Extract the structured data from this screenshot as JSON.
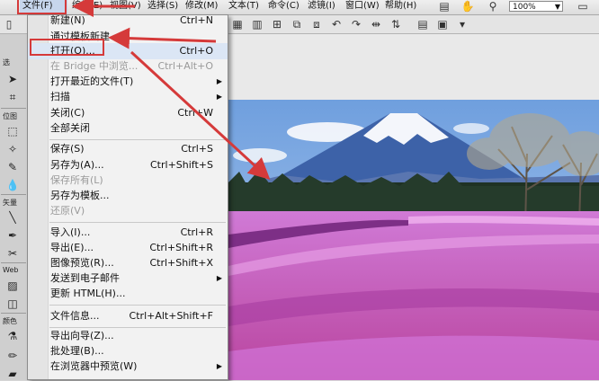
{
  "menubar": {
    "items": [
      {
        "label": "文件(F)"
      },
      {
        "label": "编辑(E)"
      },
      {
        "label": "视图(V)"
      },
      {
        "label": "选择(S)"
      },
      {
        "label": "修改(M)"
      },
      {
        "label": "文本(T)"
      },
      {
        "label": "命令(C)"
      },
      {
        "label": "滤镜(I)"
      },
      {
        "label": "窗口(W)"
      },
      {
        "label": "帮助(H)"
      }
    ],
    "zoom": "100%"
  },
  "tools": {
    "labels": [
      "选",
      "位图",
      "矢量",
      "Web",
      "颜色"
    ]
  },
  "file_menu": {
    "items": [
      {
        "label": "新建(N)",
        "shortcut": "Ctrl+N"
      },
      {
        "label": "通过模板新建"
      },
      {
        "label": "打开(O)...",
        "shortcut": "Ctrl+O"
      },
      {
        "label": "在 Bridge 中浏览...",
        "shortcut": "Ctrl+Alt+O"
      },
      {
        "label": "打开最近的文件(T)"
      },
      {
        "label": "扫描"
      },
      {
        "label": "关闭(C)",
        "shortcut": "Ctrl+W"
      },
      {
        "label": "全部关闭"
      },
      {
        "label": "保存(S)",
        "shortcut": "Ctrl+S"
      },
      {
        "label": "另存为(A)...",
        "shortcut": "Ctrl+Shift+S"
      },
      {
        "label": "保存所有(L)"
      },
      {
        "label": "另存为模板..."
      },
      {
        "label": "还原(V)"
      },
      {
        "label": "导入(I)...",
        "shortcut": "Ctrl+R"
      },
      {
        "label": "导出(E)...",
        "shortcut": "Ctrl+Shift+R"
      },
      {
        "label": "图像预览(R)...",
        "shortcut": "Ctrl+Shift+X"
      },
      {
        "label": "发送到电子邮件"
      },
      {
        "label": "更新 HTML(H)..."
      },
      {
        "label": "文件信息...",
        "shortcut": "Ctrl+Alt+Shift+F"
      },
      {
        "label": "导出向导(Z)..."
      },
      {
        "label": "批处理(B)..."
      },
      {
        "label": "在浏览器中预览(W)"
      }
    ]
  },
  "colors": {
    "annotation": "#d53a3a",
    "sky": "#8fb5e6",
    "flowers": "#c45bc6"
  }
}
